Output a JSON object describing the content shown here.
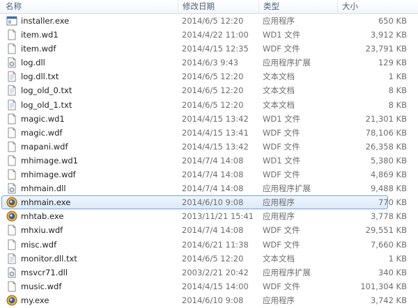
{
  "columns": {
    "name": "名称",
    "date": "修改日期",
    "type": "类型",
    "size": "大小"
  },
  "files": [
    {
      "name": "installer.exe",
      "date": "2014/6/5 12:20",
      "type": "应用程序",
      "size": "650 KB",
      "icon": "app-window-icon"
    },
    {
      "name": "item.wd1",
      "date": "2014/4/22 11:00",
      "type": "WD1 文件",
      "size": "3,912 KB",
      "icon": "blank-file-icon"
    },
    {
      "name": "item.wdf",
      "date": "2014/4/15 12:35",
      "type": "WDF 文件",
      "size": "23,791 KB",
      "icon": "blank-file-icon"
    },
    {
      "name": "log.dll",
      "date": "2014/6/3 9:43",
      "type": "应用程序扩展",
      "size": "129 KB",
      "icon": "dll-gear-icon"
    },
    {
      "name": "log.dll.txt",
      "date": "2014/6/5 12:20",
      "type": "文本文档",
      "size": "1 KB",
      "icon": "text-file-icon"
    },
    {
      "name": "log_old_0.txt",
      "date": "2014/6/5 12:20",
      "type": "文本文档",
      "size": "8 KB",
      "icon": "text-file-icon"
    },
    {
      "name": "log_old_1.txt",
      "date": "2014/6/5 12:20",
      "type": "文本文档",
      "size": "8 KB",
      "icon": "text-file-icon"
    },
    {
      "name": "magic.wd1",
      "date": "2014/4/15 13:42",
      "type": "WD1 文件",
      "size": "21,301 KB",
      "icon": "blank-file-icon"
    },
    {
      "name": "magic.wdf",
      "date": "2014/4/15 13:41",
      "type": "WDF 文件",
      "size": "78,106 KB",
      "icon": "blank-file-icon"
    },
    {
      "name": "mapani.wdf",
      "date": "2014/4/15 13:42",
      "type": "WDF 文件",
      "size": "26,358 KB",
      "icon": "blank-file-icon"
    },
    {
      "name": "mhimage.wd1",
      "date": "2014/7/4 14:08",
      "type": "WD1 文件",
      "size": "5,380 KB",
      "icon": "blank-file-icon"
    },
    {
      "name": "mhimage.wdf",
      "date": "2014/7/4 14:08",
      "type": "WDF 文件",
      "size": "4,869 KB",
      "icon": "blank-file-icon"
    },
    {
      "name": "mhmain.dll",
      "date": "2014/7/4 14:08",
      "type": "应用程序扩展",
      "size": "9,488 KB",
      "icon": "dll-gear-icon"
    },
    {
      "name": "mhmain.exe",
      "date": "2014/6/10 9:08",
      "type": "应用程序",
      "size": "770 KB",
      "icon": "game-app-icon",
      "selected": "yes"
    },
    {
      "name": "mhtab.exe",
      "date": "2013/11/21 15:41",
      "type": "应用程序",
      "size": "3,778 KB",
      "icon": "game-app-icon"
    },
    {
      "name": "mhxiu.wdf",
      "date": "2014/7/4 14:08",
      "type": "WDF 文件",
      "size": "29,551 KB",
      "icon": "blank-file-icon"
    },
    {
      "name": "misc.wdf",
      "date": "2014/6/21 11:38",
      "type": "WDF 文件",
      "size": "7,660 KB",
      "icon": "blank-file-icon"
    },
    {
      "name": "monitor.dll.txt",
      "date": "2014/6/5 12:20",
      "type": "文本文档",
      "size": "1 KB",
      "icon": "text-file-icon"
    },
    {
      "name": "msvcr71.dll",
      "date": "2003/2/21 20:42",
      "type": "应用程序扩展",
      "size": "340 KB",
      "icon": "dll-gear-icon"
    },
    {
      "name": "music.wdf",
      "date": "2014/4/15 14:00",
      "type": "WDF 文件",
      "size": "101,304 KB",
      "icon": "blank-file-icon"
    },
    {
      "name": "my.exe",
      "date": "2014/6/10 9:08",
      "type": "应用程序",
      "size": "3,742 KB",
      "icon": "game-app-icon"
    }
  ]
}
